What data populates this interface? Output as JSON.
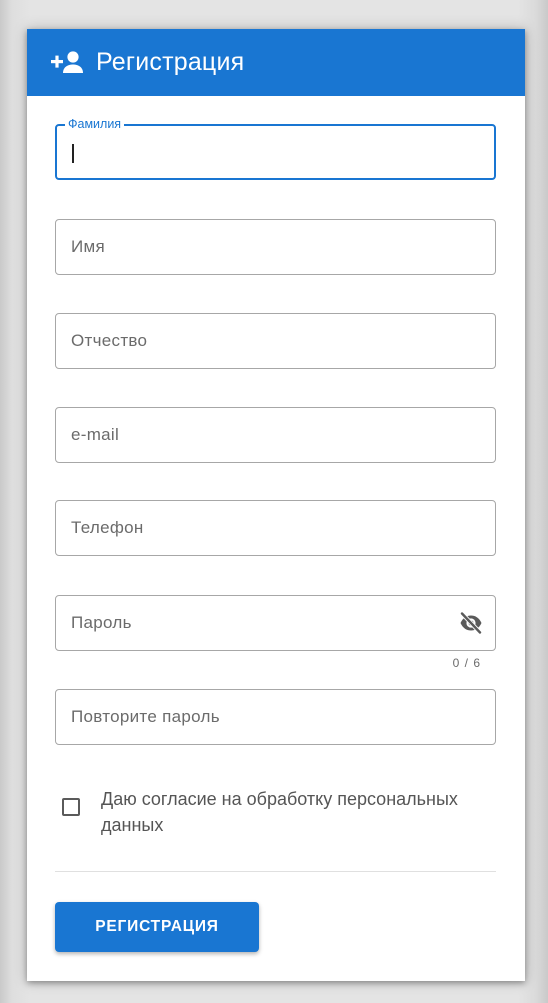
{
  "header": {
    "title": "Регистрация",
    "icon": "person-add-icon"
  },
  "form": {
    "last_name": {
      "label": "Фамилия",
      "value": ""
    },
    "first_name": {
      "label": "Имя",
      "value": ""
    },
    "middle_name": {
      "label": "Отчество",
      "value": ""
    },
    "email": {
      "label": "e-mail",
      "value": ""
    },
    "phone": {
      "label": "Телефон",
      "value": ""
    },
    "password": {
      "label": "Пароль",
      "value": "",
      "counter": "0 / 6",
      "toggle_icon": "eye-off-icon"
    },
    "password_repeat": {
      "label": "Повторите пароль",
      "value": ""
    },
    "consent": {
      "label": "Даю согласие на обработку персональных данных",
      "checked": false
    },
    "submit_label": "РЕГИСТРАЦИЯ"
  },
  "colors": {
    "primary": "#1976d2",
    "border": "#a7a7a7",
    "label": "#6b6b6b"
  }
}
